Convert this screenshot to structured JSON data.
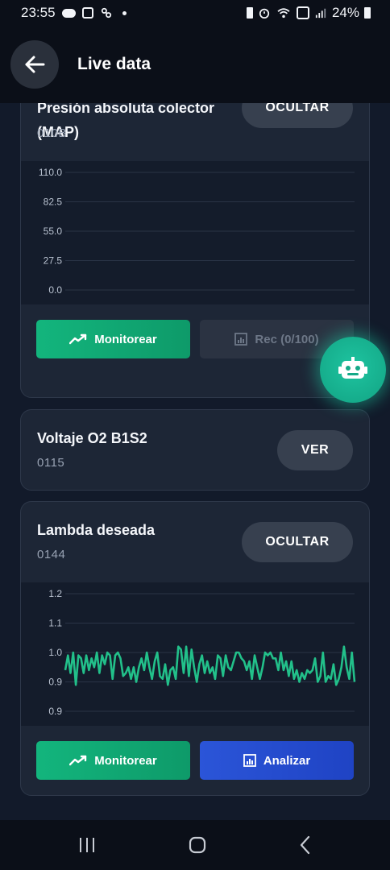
{
  "status_bar": {
    "time": "23:55",
    "battery": "24%",
    "icons_left": [
      "cloud-icon",
      "image-icon",
      "link-icon",
      "dot-icon"
    ],
    "icons_right": [
      "battery-saver-icon",
      "alarm-icon",
      "wifi-icon",
      "volte-icon",
      "signal-icon",
      "battery-icon"
    ]
  },
  "header": {
    "title": "Live data"
  },
  "cards": [
    {
      "title": "Presión absoluta colector (MAP)",
      "code": "010B",
      "toggle_label": "OCULTAR",
      "chart_data": {
        "type": "line",
        "y_ticks": [
          "110.0",
          "82.5",
          "55.0",
          "27.5",
          "0.0"
        ],
        "ylim": [
          0,
          110
        ],
        "series": []
      },
      "actions": [
        {
          "label": "Monitorear",
          "icon": "trend-icon"
        },
        {
          "label": "Rec (0/100)",
          "icon": "chart-icon"
        }
      ]
    },
    {
      "title": "Voltaje O2 B1S2",
      "code": "0115",
      "toggle_label": "VER"
    },
    {
      "title": "Lambda deseada",
      "code": "0144",
      "toggle_label": "OCULTAR",
      "chart_data": {
        "type": "line",
        "y_ticks": [
          "1.2",
          "1.1",
          "1.0",
          "0.9",
          "0.9"
        ],
        "ylim": [
          0.85,
          1.25
        ],
        "series": [
          {
            "values": [
              0.99,
              1.04,
              0.98,
              1.05,
              0.94,
              1.04,
              1.03,
              0.98,
              1.04,
              0.99,
              1.03,
              1.0,
              1.05,
              0.98,
              1.04,
              1.01,
              1.05,
              1.04,
              0.96,
              1.04,
              1.05,
              1.03,
              0.97,
              0.98,
              1.0,
              0.96,
              1.0,
              0.95,
              1.0,
              1.03,
              0.99,
              1.05,
              1.0,
              0.96,
              1.02,
              1.05,
              0.97,
              0.96,
              1.01,
              0.94,
              0.99,
              1.0,
              0.96,
              1.07,
              1.06,
              0.98,
              1.07,
              0.97,
              1.06,
              1.0,
              0.95,
              1.01,
              1.04,
              0.98,
              1.02,
              0.98,
              1.0,
              0.96,
              1.04,
              1.03,
              0.97,
              1.04,
              1.0,
              0.99,
              1.02,
              1.05,
              1.05,
              1.03,
              1.02,
              0.99,
              1.02,
              0.96,
              1.04,
              1.0,
              0.96,
              1.0,
              1.05,
              1.04,
              1.05,
              1.03,
              1.03,
              0.99,
              1.05,
              0.99,
              1.02,
              0.97,
              1.02,
              0.96,
              0.99,
              0.95,
              0.98,
              0.96,
              0.99,
              0.98,
              0.99,
              1.03,
              0.95,
              0.97,
              1.05,
              0.95,
              0.97,
              0.96,
              1.01,
              0.94,
              0.96,
              1.0,
              1.07,
              1.0,
              0.96,
              1.05,
              0.95
            ]
          }
        ]
      },
      "actions": [
        {
          "label": "Monitorear",
          "icon": "trend-icon"
        },
        {
          "label": "Analizar",
          "icon": "chart-icon"
        }
      ]
    }
  ],
  "fab": {
    "icon": "robot-icon"
  },
  "nav_bar": {
    "items": [
      "recents-icon",
      "home-icon",
      "back-icon"
    ]
  },
  "colors": {
    "accent_green": "#13b57d",
    "accent_blue": "#2b55d8",
    "series_line": "#22c08a",
    "fab": "#1ec4a0"
  }
}
